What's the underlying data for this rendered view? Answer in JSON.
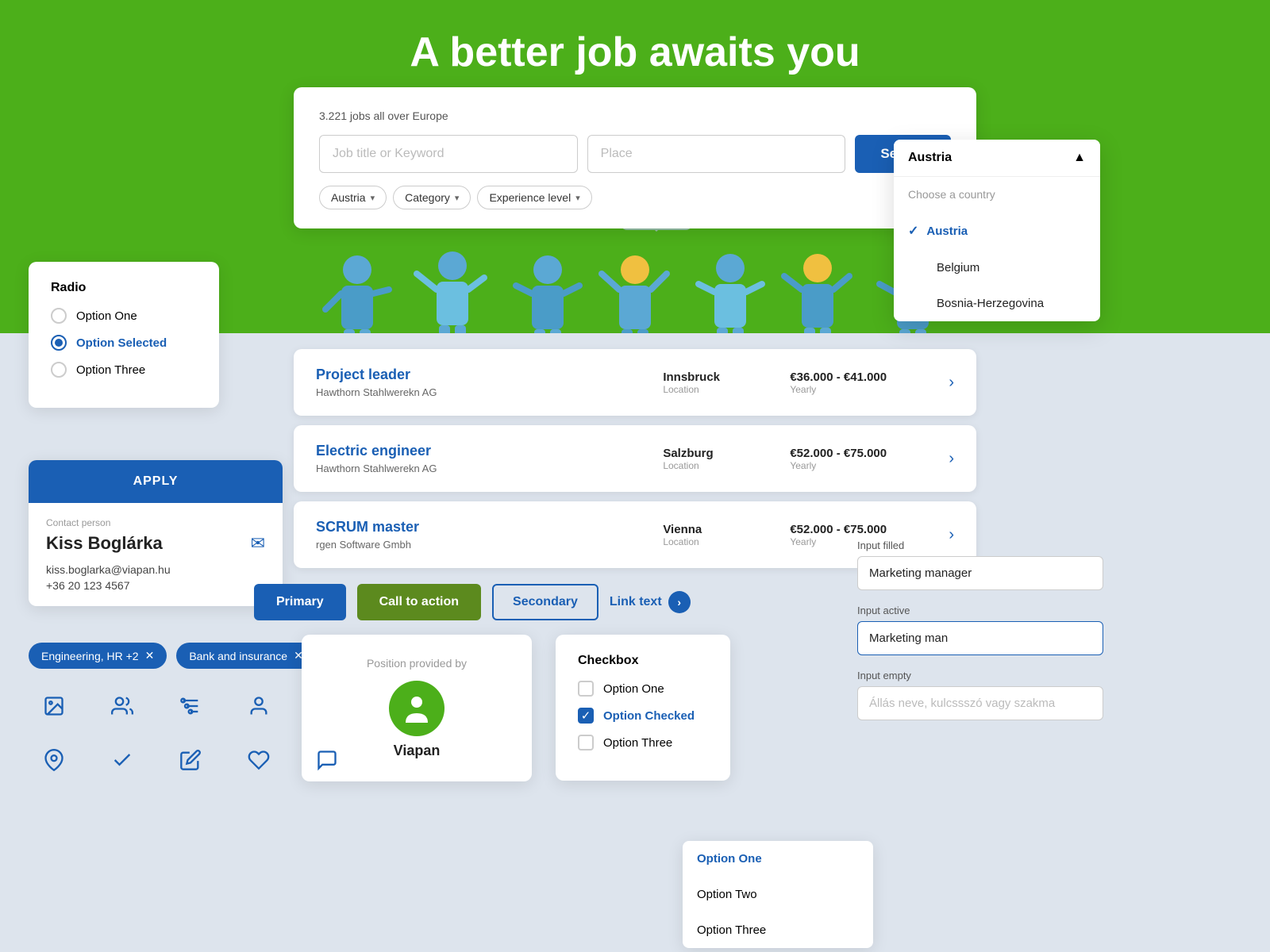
{
  "hero": {
    "title": "A better job awaits you"
  },
  "search": {
    "count_text": "3.221 jobs all over Europe",
    "keyword_placeholder": "Job title or Keyword",
    "place_placeholder": "Place",
    "search_label": "Search",
    "filters": [
      {
        "label": "Austria",
        "id": "country-filter"
      },
      {
        "label": "Category",
        "id": "category-filter"
      },
      {
        "label": "Experience level",
        "id": "experience-filter"
      }
    ]
  },
  "jobs": [
    {
      "title": "Project leader",
      "company": "Hawthorn Stahlwerekn AG",
      "city": "Innsbruck",
      "location_label": "Location",
      "salary": "€36.000 - €41.000",
      "period": "Yearly"
    },
    {
      "title": "Electric engineer",
      "company": "Hawthorn Stahlwerekn AG",
      "city": "Salzburg",
      "location_label": "Location",
      "salary": "€52.000 - €75.000",
      "period": "Yearly"
    },
    {
      "title": "SCRUM master",
      "company": "rgen Software Gmbh",
      "city": "Vienna",
      "location_label": "Location",
      "salary": "€52.000 - €75.000",
      "period": "Yearly"
    }
  ],
  "radio": {
    "title": "Radio",
    "options": [
      {
        "label": "Option One",
        "state": "unselected"
      },
      {
        "label": "Option Selected",
        "state": "selected"
      },
      {
        "label": "Option Three",
        "state": "unselected"
      }
    ]
  },
  "contact": {
    "apply_label": "APPLY",
    "contact_person_label": "Contact person",
    "name": "Kiss Boglárka",
    "email": "kiss.boglarka@viapan.hu",
    "phone": "+36 20 123 4567"
  },
  "buttons": {
    "primary_label": "Primary",
    "cta_label": "Call to action",
    "secondary_label": "Secondary",
    "link_label": "Link text"
  },
  "tags": [
    {
      "label": "Engineering, HR +2"
    },
    {
      "label": "Bank and insurance"
    }
  ],
  "country_dropdown": {
    "header_label": "Austria",
    "placeholder": "Choose a country",
    "options": [
      {
        "label": "Austria",
        "selected": true
      },
      {
        "label": "Belgium",
        "selected": false
      },
      {
        "label": "Bosnia-Herzegovina",
        "selected": false
      }
    ]
  },
  "inputs": {
    "filled_label": "Input filled",
    "filled_value": "Marketing manager",
    "active_label": "Input active",
    "active_value": "Marketing man",
    "empty_label": "Input empty",
    "empty_placeholder": "Állás neve, kulcssszó vagy szakma"
  },
  "position": {
    "label": "Position provided by",
    "company": "Viapan"
  },
  "checkbox": {
    "title": "Checkbox",
    "options": [
      {
        "label": "Option One",
        "state": "unchecked"
      },
      {
        "label": "Option Checked",
        "state": "checked"
      },
      {
        "label": "Option Three",
        "state": "unchecked"
      }
    ]
  },
  "bottom_dropdown": {
    "options": [
      {
        "label": "Option One",
        "state": "selected"
      },
      {
        "label": "Option Two",
        "state": "normal"
      },
      {
        "label": "Option Three",
        "state": "normal"
      }
    ]
  },
  "icons": {
    "row1": [
      "image-icon",
      "people-icon",
      "settings-icon",
      "person-icon",
      "search-icon"
    ],
    "row2": [
      "location-icon",
      "check-icon",
      "edit-icon",
      "heart-icon",
      "chat-icon"
    ]
  }
}
